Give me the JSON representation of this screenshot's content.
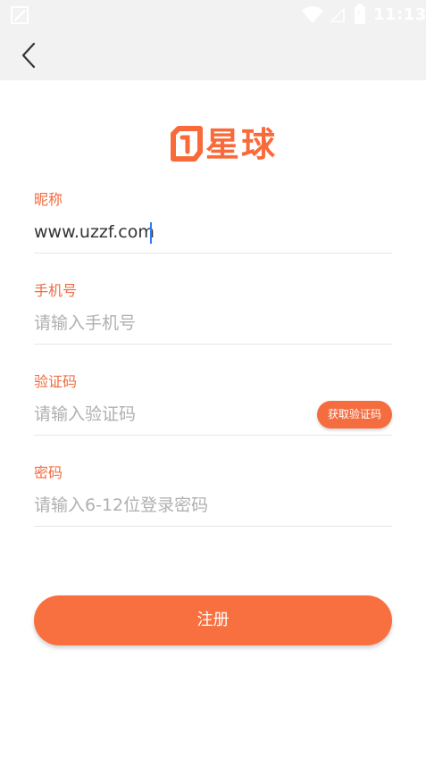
{
  "status_bar": {
    "time": "11:13",
    "icons": [
      "notification-icon",
      "wifi-icon",
      "signal-icon",
      "battery-icon"
    ]
  },
  "toolbar": {
    "back_icon": "chevron-left-icon"
  },
  "logo": {
    "text": "星球",
    "color": "#f96a3a"
  },
  "form": {
    "nickname": {
      "label": "昵称",
      "value": "www.uzzf.com"
    },
    "phone": {
      "label": "手机号",
      "placeholder": "请输入手机号"
    },
    "code": {
      "label": "验证码",
      "placeholder": "请输入验证码",
      "button_label": "获取验证码"
    },
    "password": {
      "label": "密码",
      "placeholder": "请输入6-12位登录密码"
    }
  },
  "submit": {
    "label": "注册"
  },
  "colors": {
    "accent": "#f97040",
    "label": "#f26a3f",
    "caret": "#2f7cf6"
  }
}
